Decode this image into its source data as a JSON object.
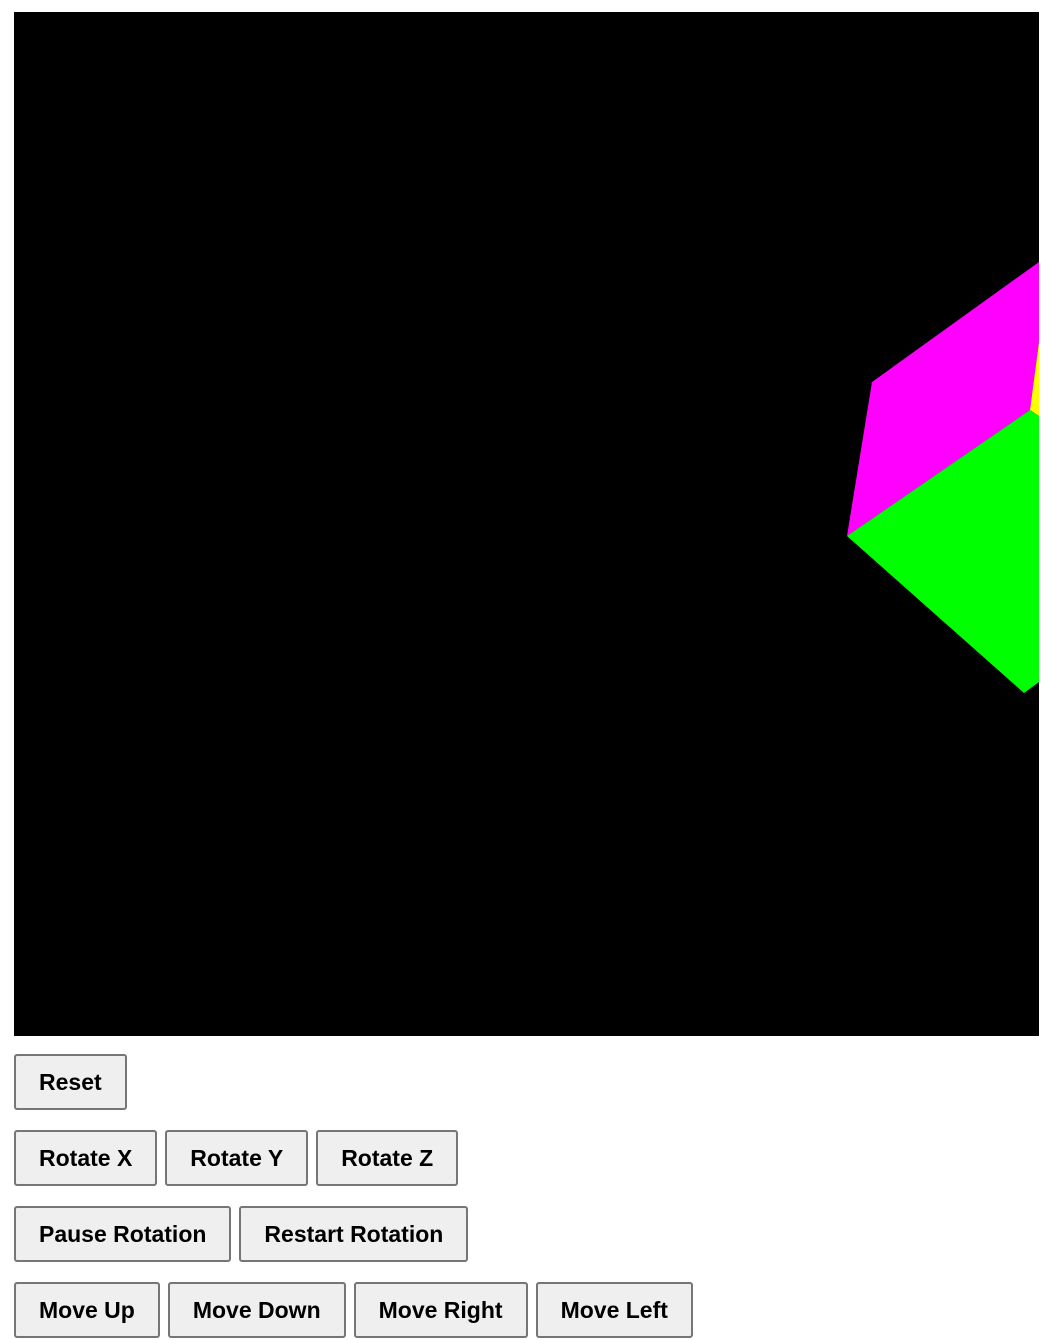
{
  "viewport": {
    "background": "#000000",
    "cube_faces": [
      {
        "name": "top-face",
        "color": "#ff00ff"
      },
      {
        "name": "front-face",
        "color": "#00ff00"
      },
      {
        "name": "side-face",
        "color": "#ffff00"
      }
    ]
  },
  "controls": {
    "reset": "Reset",
    "rotate_x": "Rotate X",
    "rotate_y": "Rotate Y",
    "rotate_z": "Rotate Z",
    "pause_rotation": "Pause Rotation",
    "restart_rotation": "Restart Rotation",
    "move_up": "Move Up",
    "move_down": "Move Down",
    "move_right": "Move Right",
    "move_left": "Move Left"
  }
}
